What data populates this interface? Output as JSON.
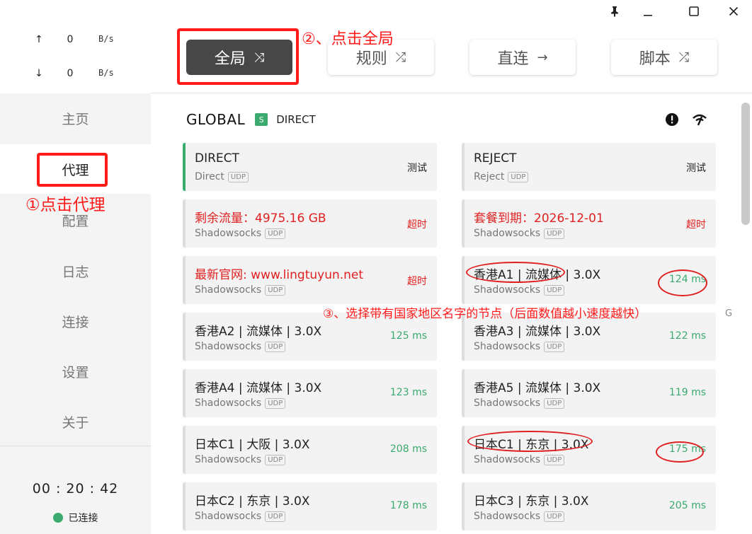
{
  "titlebar": {
    "pin_icon": "pin-icon",
    "minimize_icon": "minimize-icon",
    "maximize_icon": "maximize-icon",
    "close_icon": "close-icon"
  },
  "traffic": {
    "upload": {
      "arrow": "↑",
      "value": "0",
      "unit": "B/s"
    },
    "download": {
      "arrow": "↓",
      "value": "0",
      "unit": "B/s"
    }
  },
  "nav": {
    "home": "主页",
    "proxy": "代理",
    "config": "配置",
    "logs": "日志",
    "connections": "连接",
    "settings": "设置",
    "about": "关于"
  },
  "footer": {
    "timer": "00 : 20 : 42",
    "status": "已连接",
    "status_color": "#3aaa6e"
  },
  "modes": {
    "global": {
      "label": "全局",
      "icon": "⤨"
    },
    "rule": {
      "label": "规则",
      "icon": "⤮"
    },
    "direct": {
      "label": "直连",
      "icon": "→"
    },
    "script": {
      "label": "脚本",
      "icon": "⤮"
    }
  },
  "group": {
    "title": "GLOBAL",
    "badge": "S",
    "current": "DIRECT"
  },
  "proxies": [
    {
      "name": "DIRECT",
      "type": "Direct",
      "udp": "UDP",
      "latency": "测试",
      "kind": "test",
      "warn": false
    },
    {
      "name": "REJECT",
      "type": "Reject",
      "udp": "UDP",
      "latency": "测试",
      "kind": "test",
      "warn": false
    },
    {
      "name": "剩余流量：4975.16 GB",
      "type": "Shadowsocks",
      "udp": "UDP",
      "latency": "超时",
      "kind": "timeout",
      "warn": true
    },
    {
      "name": "套餐到期：2026-12-01",
      "type": "Shadowsocks",
      "udp": "UDP",
      "latency": "超时",
      "kind": "timeout",
      "warn": true
    },
    {
      "name": "最新官网: www.lingtuyun.net",
      "type": "Shadowsocks",
      "udp": "UDP",
      "latency": "超时",
      "kind": "timeout",
      "warn": true
    },
    {
      "name": "香港A1 | 流媒体 | 3.0X",
      "type": "Shadowsocks",
      "udp": "UDP",
      "latency": "124 ms",
      "kind": "ok",
      "warn": false
    },
    {
      "name": "香港A2 | 流媒体 | 3.0X",
      "type": "Shadowsocks",
      "udp": "UDP",
      "latency": "125 ms",
      "kind": "ok",
      "warn": false
    },
    {
      "name": "香港A3 | 流媒体 | 3.0X",
      "type": "Shadowsocks",
      "udp": "UDP",
      "latency": "122 ms",
      "kind": "ok",
      "warn": false
    },
    {
      "name": "香港A4 | 流媒体 | 3.0X",
      "type": "Shadowsocks",
      "udp": "UDP",
      "latency": "123 ms",
      "kind": "ok",
      "warn": false
    },
    {
      "name": "香港A5 | 流媒体 | 3.0X",
      "type": "Shadowsocks",
      "udp": "UDP",
      "latency": "119 ms",
      "kind": "ok",
      "warn": false
    },
    {
      "name": "日本C1 | 大阪 | 3.0X",
      "type": "Shadowsocks",
      "udp": "UDP",
      "latency": "208 ms",
      "kind": "ok",
      "warn": false
    },
    {
      "name": "日本C1 | 东京 | 3.0X",
      "type": "Shadowsocks",
      "udp": "UDP",
      "latency": "175 ms",
      "kind": "ok",
      "warn": false
    },
    {
      "name": "日本C2 | 东京 | 3.0X",
      "type": "Shadowsocks",
      "udp": "UDP",
      "latency": "178 ms",
      "kind": "ok",
      "warn": false
    },
    {
      "name": "日本C3 | 东京 | 3.0X",
      "type": "Shadowsocks",
      "udp": "UDP",
      "latency": "205 ms",
      "kind": "ok",
      "warn": false
    }
  ],
  "stray_text": "G",
  "annotations": {
    "step1": "①点击代理",
    "step2": "②、点击全局",
    "step3": "③、选择带有国家地区名字的节点（后面数值越小速度越快）",
    "color": "#ff1a1a"
  },
  "colors": {
    "accent_green": "#3aaa6e",
    "warn_red": "#e02020",
    "active_mode_bg": "#474747"
  }
}
